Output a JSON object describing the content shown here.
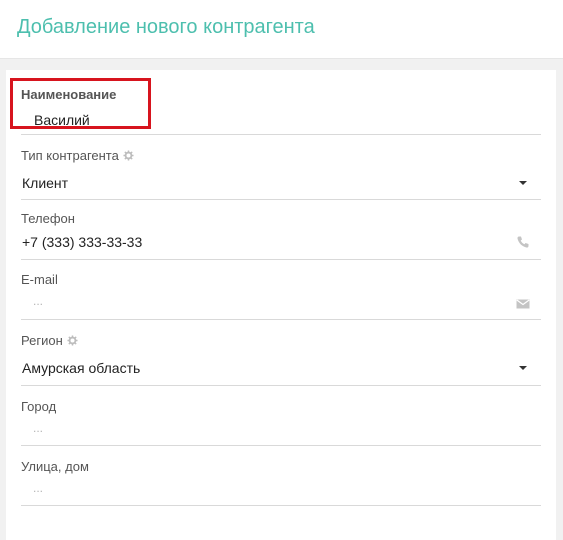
{
  "header": {
    "title": "Добавление нового контрагента"
  },
  "form": {
    "name": {
      "label": "Наименование",
      "value": "Василий"
    },
    "contractor_type": {
      "label": "Тип контрагента",
      "value": "Клиент"
    },
    "phone": {
      "label": "Телефон",
      "value": "+7 (333) 333-33-33"
    },
    "email": {
      "label": "E-mail",
      "placeholder": "..."
    },
    "region": {
      "label": "Регион",
      "value": "Амурская область"
    },
    "city": {
      "label": "Город",
      "placeholder": "..."
    },
    "street": {
      "label": "Улица, дом",
      "placeholder": "..."
    }
  },
  "colors": {
    "title": "#4dbfae",
    "highlight": "#d7141e"
  },
  "icons": {
    "gear": "gear-icon",
    "phone": "phone-icon",
    "email": "envelope-icon",
    "caret": "caret-down-icon"
  }
}
